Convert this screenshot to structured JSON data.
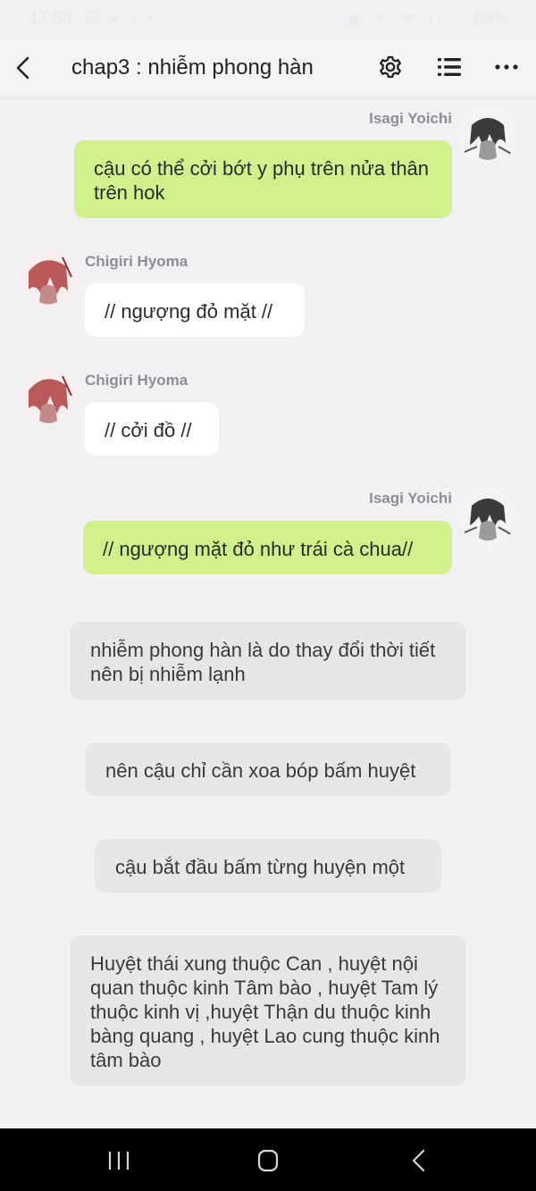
{
  "status_bar": {
    "time": "17:58",
    "battery": "60%"
  },
  "header": {
    "title": "chap3 : nhiễm phong hàn"
  },
  "messages": [
    {
      "sender": "Isagi Yoichi",
      "text": "cậu có thể cởi bớt y phụ trên nửa thân trên hok"
    },
    {
      "sender": "Chigiri Hyoma",
      "text": "// ngượng đỏ mặt //"
    },
    {
      "sender": "Chigiri Hyoma",
      "text": "// cởi đồ //"
    },
    {
      "sender": "Isagi Yoichi",
      "text": "// ngượng mặt đỏ như trái cà chua//"
    }
  ],
  "narration": [
    "nhiễm phong hàn là do thay đổi thời tiết nên bị nhiễm lạnh",
    "nên cậu chỉ cần xoa bóp bấm huyệt",
    "cậu bắt đầu bấm từng huyện một",
    "Huyệt thái xung thuộc Can , huyệt nội quan thuộc kinh Tâm bào , huyệt Tam lý thuộc kinh vị ,huyệt Thận du thuộc kinh bàng quang , huyệt Lao cung thuộc kinh tâm bào"
  ],
  "colors": {
    "green_bubble": "#cff08a",
    "white_bubble": "#ffffff",
    "narration_bubble": "#e6e6e9",
    "background": "#f1f1f3",
    "sender_name": "#8d8d94"
  },
  "icons": {
    "back": "chevron-left-icon",
    "settings": "gear-icon",
    "chapters": "list-icon",
    "more": "more-dots-icon"
  }
}
